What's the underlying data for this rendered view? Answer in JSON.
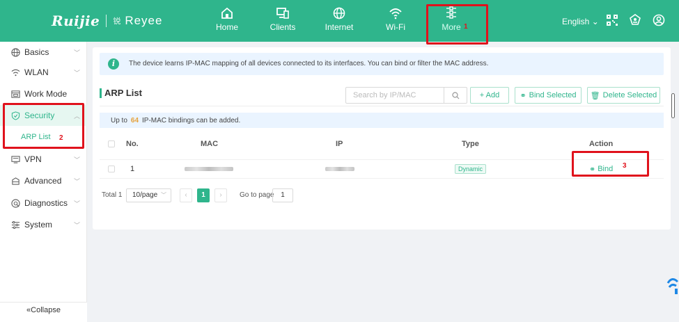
{
  "header": {
    "brand": "Ruijie",
    "subbrand": "Reyee",
    "subbrand_mark": "锐",
    "nav": [
      {
        "label": "Home",
        "icon": "home-icon"
      },
      {
        "label": "Clients",
        "icon": "clients-icon"
      },
      {
        "label": "Internet",
        "icon": "globe-icon"
      },
      {
        "label": "Wi-Fi",
        "icon": "wifi-icon"
      },
      {
        "label": "More",
        "icon": "more-icon"
      }
    ],
    "language": "English",
    "right_icons": [
      "qr-code-icon",
      "ai-assistant-icon",
      "user-icon"
    ]
  },
  "annotations": [
    "1",
    "2",
    "3"
  ],
  "annotation_color": "#e0121c",
  "sidebar": {
    "items": [
      {
        "label": "Basics",
        "icon": "globe-icon"
      },
      {
        "label": "WLAN",
        "icon": "wifi-icon"
      },
      {
        "label": "Work Mode",
        "icon": "work-mode-icon"
      },
      {
        "label": "Security",
        "icon": "shield-icon",
        "active": true
      },
      {
        "label": "VPN",
        "icon": "vpn-icon"
      },
      {
        "label": "Advanced",
        "icon": "advanced-icon"
      },
      {
        "label": "Diagnostics",
        "icon": "diagnostics-icon"
      },
      {
        "label": "System",
        "icon": "system-icon"
      }
    ],
    "subitem": "ARP List",
    "collapse_label": "«Collapse"
  },
  "main": {
    "info_text": "The device learns IP-MAC mapping of all devices connected to its interfaces. You can bind or filter the MAC address.",
    "info_icon_glyph": "i",
    "title": "ARP List",
    "search_placeholder": "Search by IP/MAC",
    "add_label": "+ Add",
    "bind_selected_label": "Bind Selected",
    "delete_selected_label": "Delete Selected",
    "limit_prefix": "Up to",
    "limit_number": "64",
    "limit_suffix": "IP-MAC bindings can be added.",
    "table": {
      "columns": [
        "No.",
        "MAC",
        "IP",
        "Type",
        "Action"
      ],
      "rows": [
        {
          "no": "1",
          "mac": "",
          "ip": "",
          "type": "Dynamic",
          "action": "Bind"
        }
      ]
    },
    "pagination": {
      "total": "Total 1",
      "page_size": "10/page",
      "current_page": "1",
      "goto_label": "Go to page",
      "goto_value": "1"
    }
  },
  "colors": {
    "brand": "#2fb58c",
    "info_bg": "#eaf4ff",
    "highlight": "#e0121c"
  }
}
